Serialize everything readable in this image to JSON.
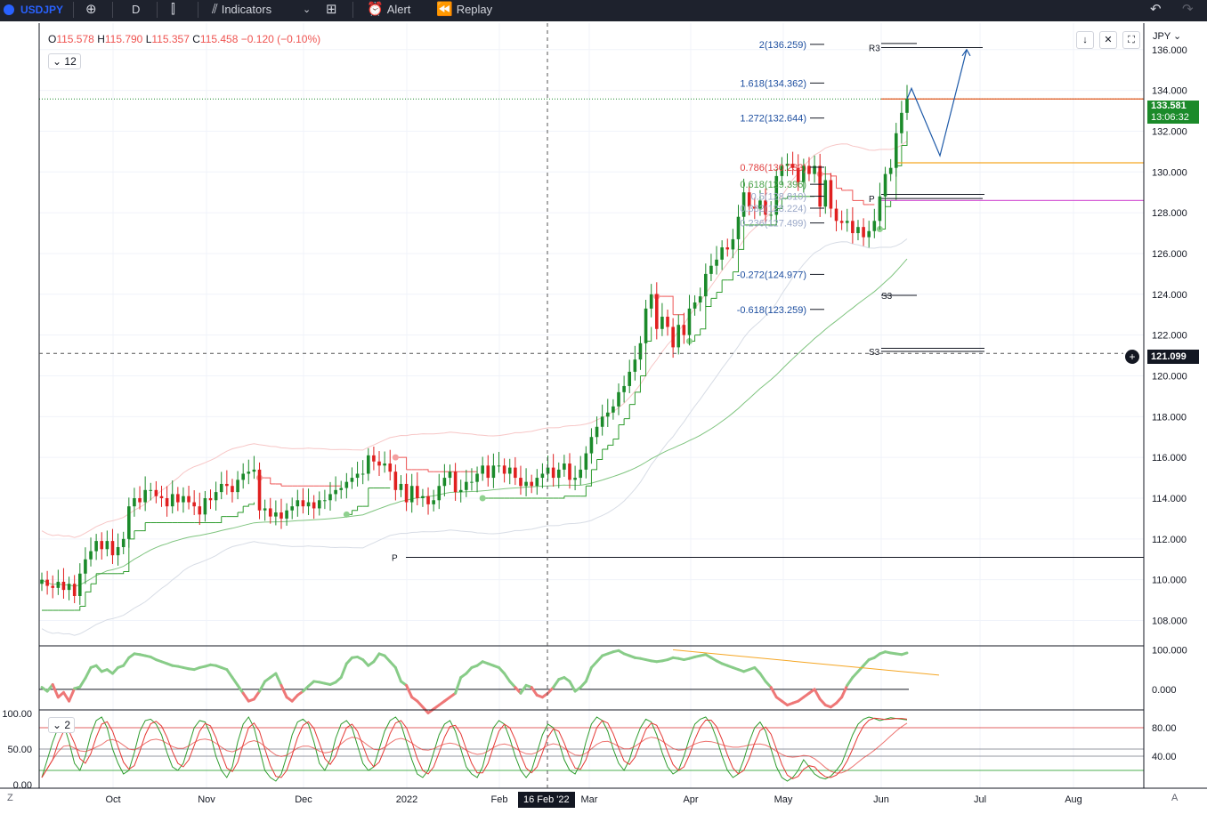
{
  "toolbar": {
    "symbol": "USDJPY",
    "interval": "D",
    "indicators_label": "Indicators",
    "alert_label": "Alert",
    "replay_label": "Replay"
  },
  "legend": {
    "open_key": "O",
    "open": "115.578",
    "high_key": "H",
    "high": "115.790",
    "low_key": "L",
    "low": "115.357",
    "close_key": "C",
    "close": "115.458",
    "change": "−0.120 (−0.10%)"
  },
  "indicator_counts": {
    "main": "12",
    "stochastic": "2"
  },
  "currency_label": "JPY",
  "price_tags": {
    "last_price": "133.581",
    "countdown": "13:06:32",
    "crosshair_price": "121.099",
    "crosshair_date": "16 Feb '22"
  },
  "bottom_buttons": {
    "left": "Z",
    "right": "A"
  },
  "colors": {
    "up": "#1b8a2a",
    "down": "#e02020",
    "bg": "#ffffff",
    "toolbar": "#1e222d",
    "fib_blue": "#1e4fa0",
    "orange": "#f5a623"
  },
  "chart_data": {
    "type": "candlestick",
    "symbol": "USDJPY",
    "interval": "D",
    "x_ticks": [
      "Oct",
      "Nov",
      "Dec",
      "2022",
      "Feb",
      "Mar",
      "Apr",
      "May",
      "Jun",
      "Jul",
      "Aug"
    ],
    "y_ticks": [
      "136.000",
      "134.000",
      "132.000",
      "130.000",
      "128.000",
      "126.000",
      "124.000",
      "122.000",
      "120.000",
      "118.000",
      "116.000",
      "114.000",
      "112.000",
      "110.000",
      "108.000"
    ],
    "ylim": [
      106.8,
      137.3
    ],
    "last_close": 133.581,
    "closes": [
      110.0,
      109.7,
      109.6,
      109.9,
      109.5,
      109.8,
      109.2,
      110.3,
      111.0,
      111.4,
      111.9,
      111.5,
      111.9,
      111.2,
      111.6,
      112.0,
      113.6,
      114.0,
      113.8,
      114.4,
      114.4,
      114.1,
      114.0,
      113.6,
      114.2,
      113.8,
      114.1,
      113.8,
      113.6,
      113.2,
      114.0,
      113.9,
      114.3,
      114.7,
      114.6,
      114.3,
      114.9,
      115.2,
      115.3,
      115.4,
      113.4,
      113.5,
      113.1,
      113.3,
      113.0,
      113.4,
      113.6,
      113.9,
      113.6,
      113.8,
      113.5,
      113.9,
      113.9,
      114.2,
      114.4,
      114.5,
      114.8,
      115.0,
      115.2,
      115.2,
      116.1,
      115.8,
      115.6,
      115.7,
      115.3,
      114.4,
      114.7,
      113.8,
      114.6,
      114.0,
      114.1,
      113.7,
      113.9,
      114.6,
      115.0,
      115.3,
      114.3,
      114.4,
      114.8,
      114.8,
      115.2,
      115.6,
      115.0,
      115.6,
      115.6,
      115.2,
      115.5,
      115.0,
      114.6,
      114.8,
      114.6,
      115.0,
      115.2,
      115.5,
      115.0,
      115.4,
      115.7,
      114.9,
      115.0,
      115.4,
      116.2,
      117.0,
      117.5,
      118.0,
      118.2,
      118.5,
      119.2,
      119.5,
      120.2,
      120.8,
      121.6,
      123.3,
      124.0,
      122.3,
      122.9,
      122.4,
      121.4,
      122.5,
      122.0,
      123.3,
      123.6,
      123.9,
      125.0,
      125.4,
      125.7,
      126.3,
      126.2,
      126.7,
      127.8,
      129.0,
      128.3,
      128.2,
      128.6,
      127.9,
      127.9,
      129.8,
      130.3,
      130.4,
      130.2,
      129.5,
      130.3,
      129.9,
      130.3,
      128.3,
      129.6,
      128.2,
      127.6,
      127.5,
      127.6,
      127.0,
      127.3,
      126.8,
      127.1,
      127.6,
      128.8,
      129.9,
      130.2,
      131.9,
      132.9,
      133.6
    ],
    "projection": [
      134.1,
      130.8,
      136.0
    ],
    "fib_levels": [
      {
        "label": "2(136.259)",
        "price": 136.259
      },
      {
        "label": "1.618(134.362)",
        "price": 134.362
      },
      {
        "label": "1.272(132.644)",
        "price": 132.644
      },
      {
        "label": "0.786(130.233)",
        "price": 130.233
      },
      {
        "label": "0.618(129.396)",
        "price": 129.396
      },
      {
        "label": "0.5(128.810)",
        "price": 128.81
      },
      {
        "label": "0.382(128.224)",
        "price": 128.224
      },
      {
        "label": "0.236(127.499)",
        "price": 127.499
      },
      {
        "label": "-0.272(124.977)",
        "price": 124.977
      },
      {
        "label": "-0.618(123.259)",
        "price": 123.259
      }
    ],
    "pivots": [
      {
        "label": "R3",
        "price": 136.1
      },
      {
        "label": "P",
        "price": 128.7
      },
      {
        "label": "S3",
        "price": 123.95
      },
      {
        "label": "S3",
        "price": 121.2
      },
      {
        "label": "P",
        "price": 111.1
      }
    ],
    "horizontal_levels": [
      {
        "price": 133.581,
        "style": "dotted-green"
      },
      {
        "price": 121.099,
        "style": "crosshair"
      }
    ],
    "oscillator": {
      "y_ticks": [
        "100.000",
        "0.000"
      ],
      "ylim": [
        -50,
        110
      ],
      "values": [
        5,
        -5,
        12,
        -20,
        -8,
        -30,
        2,
        6,
        28,
        55,
        60,
        45,
        50,
        40,
        55,
        60,
        80,
        90,
        88,
        85,
        82,
        75,
        70,
        65,
        60,
        58,
        55,
        52,
        50,
        55,
        58,
        62,
        60,
        55,
        50,
        30,
        10,
        -10,
        -30,
        -25,
        -5,
        20,
        30,
        40,
        10,
        -20,
        -30,
        -15,
        -5,
        8,
        20,
        18,
        15,
        12,
        18,
        30,
        65,
        80,
        82,
        75,
        60,
        70,
        90,
        85,
        70,
        55,
        20,
        10,
        -20,
        -30,
        -45,
        -60,
        -50,
        -40,
        -30,
        -20,
        -10,
        30,
        40,
        55,
        60,
        70,
        65,
        60,
        55,
        40,
        20,
        5,
        -10,
        10,
        5,
        -15,
        -20,
        -10,
        5,
        25,
        30,
        20,
        -5,
        5,
        20,
        55,
        70,
        85,
        90,
        95,
        98,
        90,
        85,
        80,
        78,
        75,
        72,
        70,
        72,
        75,
        80,
        78,
        75,
        78,
        82,
        85,
        88,
        80,
        72,
        65,
        60,
        55,
        50,
        45,
        50,
        55,
        40,
        20,
        5,
        -20,
        -30,
        -40,
        -35,
        -30,
        -20,
        -10,
        0,
        -25,
        -40,
        -45,
        -35,
        -20,
        10,
        30,
        45,
        60,
        75,
        80,
        90,
        95,
        92,
        90,
        88,
        92
      ]
    },
    "stochastic": {
      "y_ticks_left": [
        "100.00",
        "50.00",
        "0.00"
      ],
      "y_ticks_right": [
        "80.00",
        "40.00"
      ],
      "ylim": [
        -5,
        105
      ],
      "k": [
        10,
        35,
        60,
        80,
        85,
        60,
        30,
        20,
        40,
        70,
        90,
        95,
        80,
        50,
        30,
        15,
        20,
        45,
        75,
        90,
        92,
        85,
        70,
        45,
        25,
        20,
        30,
        55,
        80,
        90,
        88,
        70,
        40,
        20,
        10,
        25,
        60,
        85,
        95,
        80,
        50,
        20,
        10,
        5,
        15,
        40,
        70,
        88,
        92,
        85,
        60,
        30,
        20,
        35,
        65,
        85,
        90,
        80,
        55,
        30,
        20,
        25,
        50,
        75,
        90,
        95,
        85,
        60,
        35,
        15,
        10,
        20,
        45,
        70,
        85,
        90,
        75,
        50,
        25,
        15,
        10,
        25,
        55,
        80,
        90,
        85,
        65,
        40,
        20,
        10,
        20,
        45,
        70,
        85,
        80,
        60,
        35,
        20,
        15,
        30,
        60,
        85,
        95,
        90,
        75,
        50,
        30,
        20,
        35,
        60,
        80,
        92,
        88,
        70,
        45,
        25,
        15,
        20,
        40,
        65,
        85,
        92,
        95,
        85,
        65,
        40,
        20,
        10,
        15,
        35,
        60,
        80,
        88,
        75,
        50,
        25,
        10,
        5,
        10,
        20,
        35,
        25,
        15,
        10,
        8,
        12,
        20,
        30,
        50,
        70,
        85,
        92,
        95,
        93,
        90,
        92,
        94,
        93,
        92,
        91
      ]
    }
  }
}
